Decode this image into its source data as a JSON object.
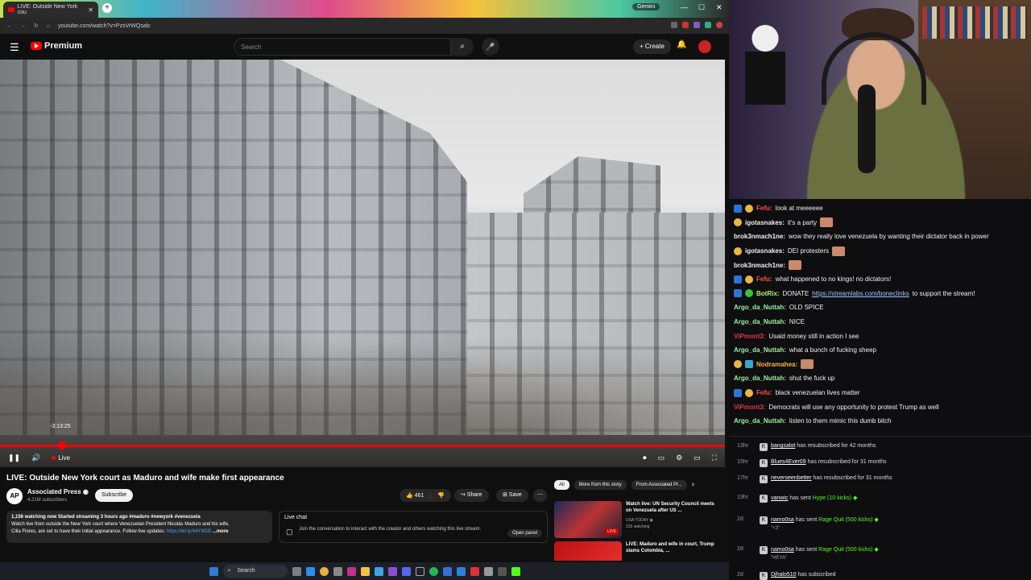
{
  "browser": {
    "tab_title": "LIVE: Outside New York cou",
    "new_tab": "+",
    "gemini_label": "Gemini",
    "url": "youtube.com/watch?v=PzsVrWQsalc",
    "win_min": "—",
    "win_max": "☐",
    "win_close": "✕"
  },
  "youtube": {
    "menu_icon": "☰",
    "logo_text": "Premium",
    "search_placeholder": "Search",
    "search_icon": "⌕",
    "mic_icon": "🎤",
    "create_label": "+ Create",
    "bell_icon": "🔔"
  },
  "player": {
    "hover_time": "-3:13:25",
    "live_label": "Live",
    "pause_icon": "❚❚",
    "volume_icon": "🔊",
    "cc_icon": "▭",
    "autoplay_icon": "⏺",
    "settings_icon": "⚙",
    "theater_icon": "▭",
    "fullscreen_icon": "⛶"
  },
  "video": {
    "title": "LIVE: Outside New York court as Maduro and wife make first appearance",
    "channel": "Associated Press ◉",
    "channel_logo": "AP",
    "subscribers": "4.21M subscribers",
    "subscribe_label": "Subscribe",
    "likes": "👍 461",
    "dislike": "👎",
    "share_label": "↪ Share",
    "save_label": "⊞ Save",
    "more_icon": "⋯",
    "description_line1": "1,156 watching now  Started streaming 3 hours ago #maduro #newyork #venezuela",
    "description_line2": "Watch live from outside the New York court where Venezuelan President Nicolás Maduro and his wife,",
    "description_line3": "Cilia Flores, are set to have their initial appearance. Follow live updates:",
    "description_link": "https://bit.ly/44Y9Oi5",
    "description_more": "...more"
  },
  "livechat": {
    "header": "Live chat",
    "icon": "▢",
    "text": "Join the conversation to interact with the creator and others watching this live stream.",
    "open_panel": "Open panel"
  },
  "related": {
    "chips": [
      "All",
      "More from this story",
      "From Associated Pr..."
    ],
    "chevron": "›",
    "items": [
      {
        "title": "Watch live: UN Security Council meets on Venezuela after US ...",
        "channel": "USA TODAY ◉",
        "meta": "315 watching",
        "badge": "LIVE"
      },
      {
        "title": "LIVE: Maduro and wife in court, Trump slams Colombia, ...",
        "channel": "",
        "meta": "",
        "badge": ""
      }
    ]
  },
  "taskbar": {
    "search_label": "Search"
  },
  "chat": {
    "messages": [
      {
        "user": "Fefu:",
        "color": "#ff4f4f",
        "text": "look at meeeeee",
        "badges": [
          "blue",
          "pea"
        ],
        "emote": false
      },
      {
        "user": "igotasnakes:",
        "color": "#f0f0f0",
        "text": "it's a party",
        "badges": [
          "pea"
        ],
        "emote": true
      },
      {
        "user": "brok3nmach1ne:",
        "color": "#f0f0f0",
        "text": "wow they really love venezuela by wanting their dictator back in power",
        "badges": [],
        "emote": false
      },
      {
        "user": "igotasnakes:",
        "color": "#f0f0f0",
        "text": "DEI protesters",
        "badges": [
          "pea"
        ],
        "emote": true
      },
      {
        "user": "brok3nmach1ne:",
        "color": "#f0f0f0",
        "text": "",
        "badges": [],
        "emote": true
      },
      {
        "user": "Fefu:",
        "color": "#ff4f4f",
        "text": "what happened to no kings! no dictators!",
        "badges": [
          "blue",
          "pea"
        ],
        "emote": false
      },
      {
        "user": "BotRix:",
        "color": "#b6f06b",
        "text": "DONATE",
        "badges": [
          "blue",
          "green"
        ],
        "emote": false,
        "link": "https://streamlabs.com/boneclinks",
        "after": "to support the stream!"
      },
      {
        "user": "Argo_da_Nuttah:",
        "color": "#9cf0a0",
        "text": "OLD SPICE",
        "badges": [],
        "emote": false
      },
      {
        "user": "Argo_da_Nuttah:",
        "color": "#9cf0a0",
        "text": "NICE",
        "badges": [],
        "emote": false
      },
      {
        "user": "ViPmont3:",
        "color": "#e0364f",
        "text": "Usaid money still in action I see",
        "badges": [],
        "emote": false
      },
      {
        "user": "Argo_da_Nuttah:",
        "color": "#9cf0a0",
        "text": "what a bunch of fucking sheep",
        "badges": [],
        "emote": false
      },
      {
        "user": "Nodramahea:",
        "color": "#ffb43a",
        "text": "",
        "badges": [
          "pea",
          "cyan"
        ],
        "emote": true
      },
      {
        "user": "Argo_da_Nuttah:",
        "color": "#9cf0a0",
        "text": "shut the fuck up",
        "badges": [],
        "emote": false
      },
      {
        "user": "Fefu:",
        "color": "#ff4f4f",
        "text": "black venezuelan lives matter",
        "badges": [
          "blue",
          "pea"
        ],
        "emote": false
      },
      {
        "user": "ViPmont3:",
        "color": "#e0364f",
        "text": "Democrats will use any opportunity to protest Trump as well",
        "badges": [],
        "emote": false
      },
      {
        "user": "Argo_da_Nuttah:",
        "color": "#9cf0a0",
        "text": "listen to them mimic this dumb bitch",
        "badges": [],
        "emote": false
      }
    ]
  },
  "events": {
    "kick_icon": "K",
    "items": [
      {
        "age": "13hr",
        "who": "bangsalot",
        "text": " has resubscribed for 42 months",
        "gift": "",
        "sub": ""
      },
      {
        "age": "15hr",
        "who": "Blues4Ever09",
        "text": " has resubscribed for 31 months",
        "gift": "",
        "sub": ""
      },
      {
        "age": "17hr",
        "who": "neverseenbetter",
        "text": " has resubscribed for 31 months",
        "gift": "",
        "sub": ""
      },
      {
        "age": "19hr",
        "who": "vanwic",
        "text": " has sent ",
        "gift": "Hype (10 kicks)",
        "sub": ""
      },
      {
        "age": "2d",
        "who": "namo0sa",
        "text": " has sent ",
        "gift": "Rage Quit (500 kicks)",
        "sub": "\"<3\""
      },
      {
        "age": "2d",
        "who": "namo0sa",
        "text": " has sent ",
        "gift": "Rage Quit (500 kicks)",
        "sub": "\"HEYA\""
      },
      {
        "age": "2d",
        "who": "Djhalo510",
        "text": " has subscribed",
        "gift": "",
        "sub": ""
      }
    ]
  }
}
